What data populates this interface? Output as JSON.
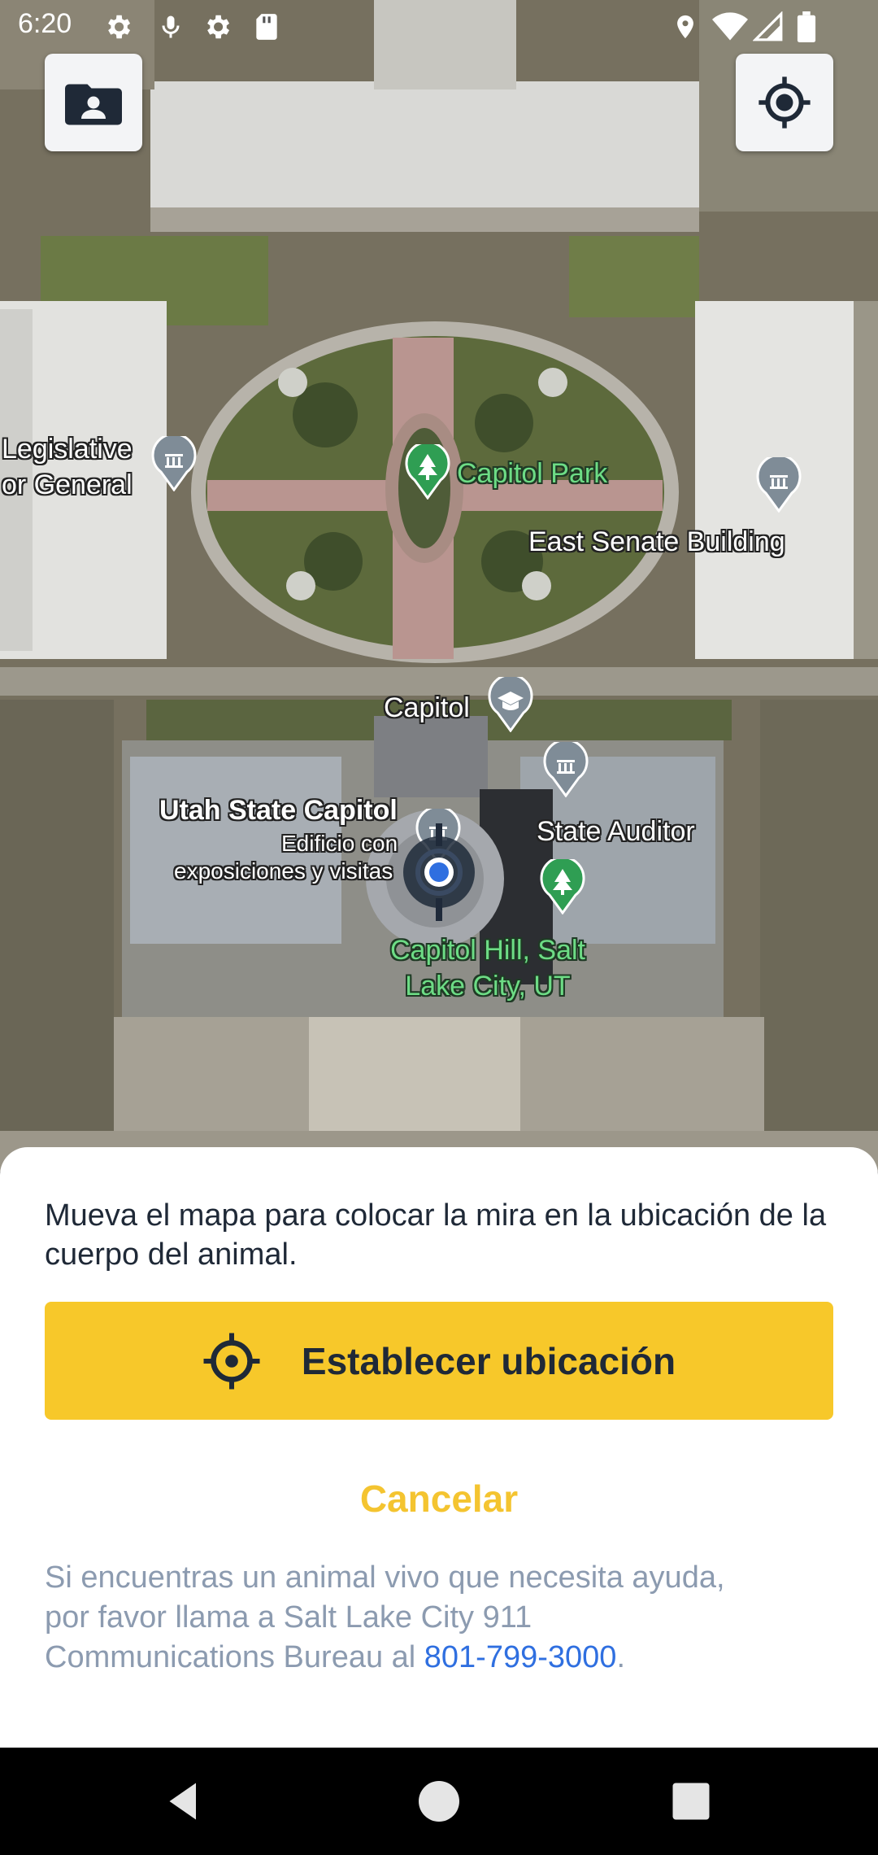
{
  "status_bar": {
    "time": "6:20",
    "icons": [
      "gear-icon",
      "mic-icon",
      "settings-icon",
      "sd-card-icon",
      "location-icon",
      "wifi-icon",
      "signal-icon",
      "battery-icon"
    ]
  },
  "map": {
    "labels": {
      "legislative_line1": "Legislative",
      "legislative_line2": "or General",
      "capitol_park": "Capitol Park",
      "east_senate": "East Senate Building",
      "capitol": "Capitol",
      "utah_state_capitol": "Utah State Capitol",
      "edificio_line1": "Edificio con",
      "edificio_line2": "exposiciones y visitas",
      "state_auditor": "State Auditor",
      "capitol_hill_line1": "Capitol Hill, Salt",
      "capitol_hill_line2": "Lake City, UT"
    },
    "buttons": {
      "left_icon": "contact-folder-icon",
      "right_icon": "my-location-icon"
    }
  },
  "sheet": {
    "instruction": "Mueva el mapa para colocar la mira en la ubicación de la cuerpo del animal.",
    "set_location_label": "Establecer ubicación",
    "cancel_label": "Cancelar",
    "help_text": "Si encuentras un animal vivo que necesita ayuda, por favor llama a Salt Lake City 911 Communications Bureau al ",
    "phone": "801-799-3000",
    "help_text_end": "."
  },
  "colors": {
    "accent": "#f7c82a",
    "cancel": "#f4c430",
    "link": "#2f6fe0",
    "help_text": "#8c9bb0"
  }
}
